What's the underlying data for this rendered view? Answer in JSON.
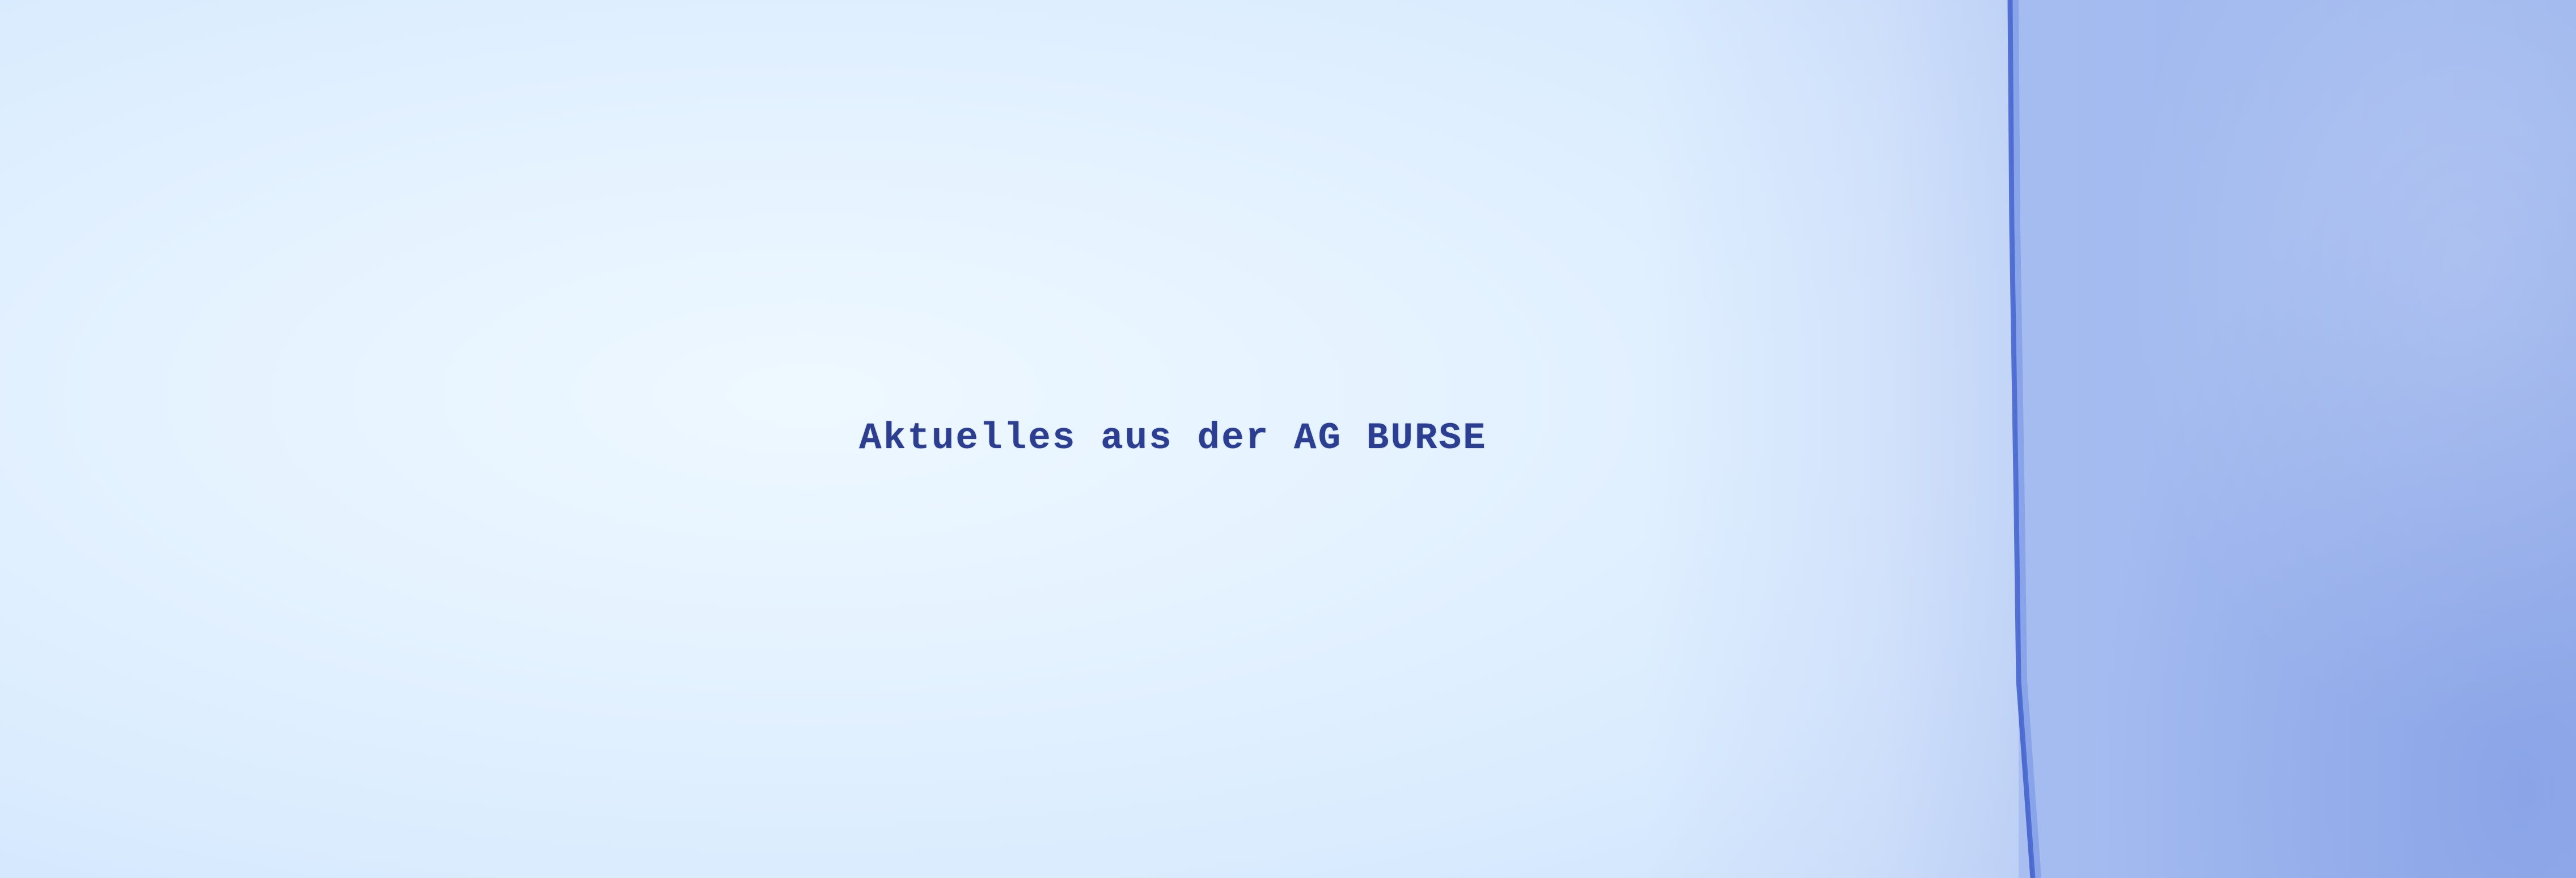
{
  "document": {
    "typed_text": "Aktuelles aus der AG BURSE"
  },
  "colors": {
    "paper": "#e4f2ff",
    "backdrop": "#9fb8ef",
    "ink": "#1d2f86"
  }
}
